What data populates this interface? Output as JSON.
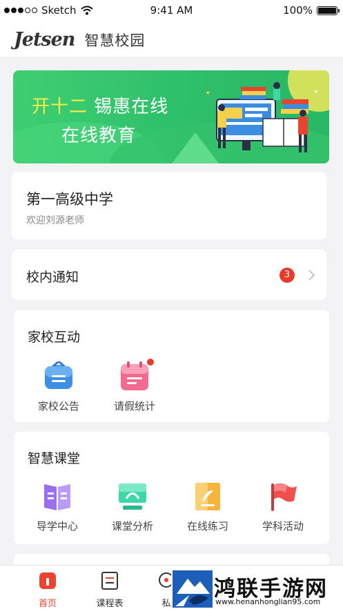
{
  "status_bar": {
    "carrier": "Sketch",
    "time": "9:41 AM",
    "battery": "100%"
  },
  "header": {
    "logo": "Jetsen",
    "title": "智慧校园"
  },
  "banner": {
    "prefix": "开十二",
    "line1_rest": " 锡惠在线",
    "line2": "在线教育",
    "colors": {
      "bg": "#2fc06b",
      "highlight": "#f7ec4c"
    }
  },
  "school": {
    "name": "第一高级中学",
    "welcome": "欢迎刘源老师"
  },
  "notice": {
    "title": "校内通知",
    "count": "3"
  },
  "home_school": {
    "title": "家校互动",
    "items": [
      {
        "label": "家校公告",
        "icon": "announcement-icon",
        "color": "#3e8ee6"
      },
      {
        "label": "请假统计",
        "icon": "leave-stats-icon",
        "color": "#f26a8d"
      }
    ]
  },
  "smart_class": {
    "title": "智慧课堂",
    "items": [
      {
        "label": "导学中心",
        "icon": "book-icon",
        "color": "#9b6ff0"
      },
      {
        "label": "课堂分析",
        "icon": "monitor-icon",
        "color": "#3fd6a8"
      },
      {
        "label": "在线练习",
        "icon": "exercise-icon",
        "color": "#f7b43c"
      },
      {
        "label": "学科活动",
        "icon": "flag-icon",
        "color": "#ee5050"
      }
    ]
  },
  "tabbar": {
    "tabs": [
      {
        "label": "首页",
        "icon": "home-icon",
        "active": true
      },
      {
        "label": "课程表",
        "icon": "schedule-icon",
        "active": false
      },
      {
        "label": "私",
        "icon": "message-icon",
        "active": false
      }
    ]
  },
  "watermark": {
    "text": "鸿联手游网",
    "url": "www.henanhonglian95.com"
  },
  "colors": {
    "accent": "#e8442f",
    "badge": "#ea3b2a",
    "page_bg": "#f3f3f5"
  }
}
